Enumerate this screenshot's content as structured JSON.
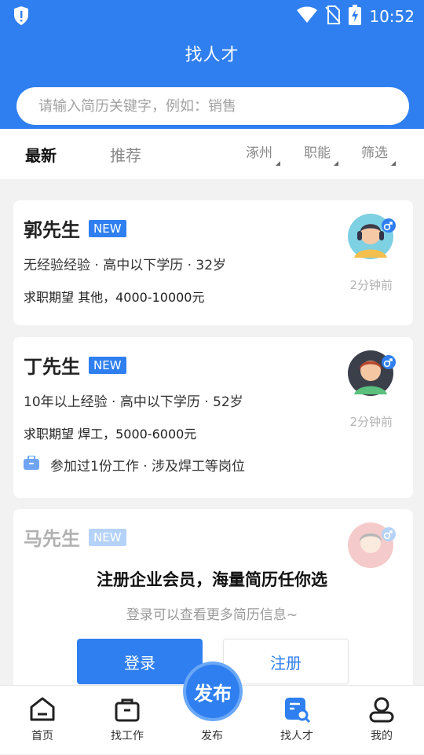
{
  "status_bar": {
    "time": "10:52"
  },
  "header": {
    "title": "找人才",
    "search_placeholder": "请输入简历关键字，例如：销售"
  },
  "tabs": {
    "latest": "最新",
    "recommend": "推荐"
  },
  "filters": {
    "location": "涿州",
    "job": "职能",
    "filter": "筛选"
  },
  "cards": [
    {
      "name": "郭先生",
      "badge": "NEW",
      "info": "无经验经验 · 高中以下学历 · 32岁",
      "expect": "求职期望 其他，4000-10000元",
      "time": "2分钟前"
    },
    {
      "name": "丁先生",
      "badge": "NEW",
      "info": "10年以上经验 · 高中以下学历 · 52岁",
      "expect": "求职期望 焊工，5000-6000元",
      "time": "2分钟前",
      "experience": "参加过1份工作 · 涉及焊工等岗位"
    },
    {
      "name": "马先生",
      "badge": "NEW"
    }
  ],
  "lock": {
    "headline": "注册企业会员，海量简历任你选",
    "sub": "登录可以查看更多简历信息~",
    "login": "登录",
    "register": "注册"
  },
  "nav": {
    "home": "首页",
    "find_job": "找工作",
    "publish": "发布",
    "publish_fab": "发布",
    "find_talent": "找人才",
    "mine": "我的"
  },
  "colors": {
    "brand": "#2f7ff0"
  }
}
